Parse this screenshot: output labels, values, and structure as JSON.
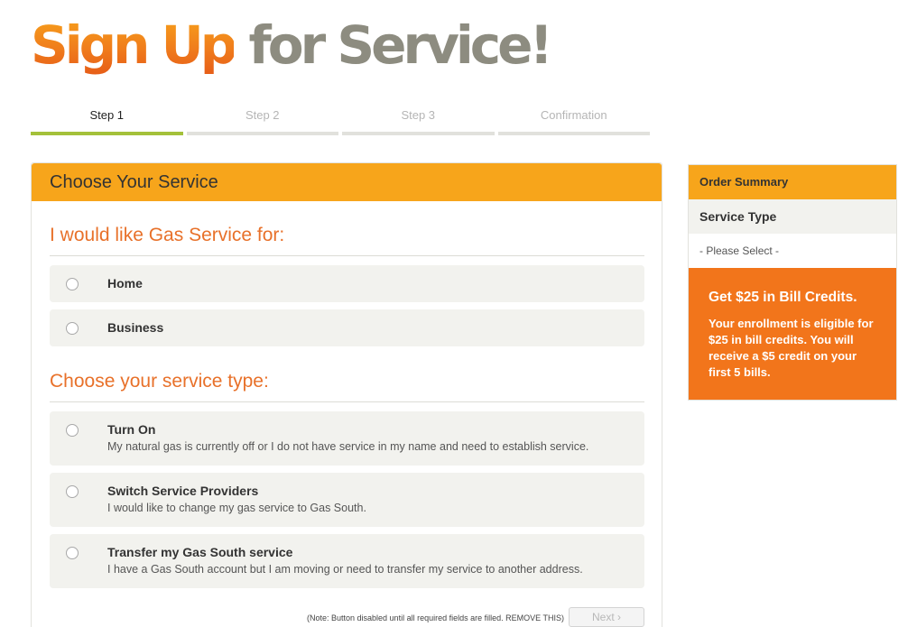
{
  "header": {
    "title_part1": "Sign Up",
    "title_part2": "for Service!"
  },
  "steps": [
    {
      "label": "Step 1",
      "active": true
    },
    {
      "label": "Step 2",
      "active": false
    },
    {
      "label": "Step 3",
      "active": false
    },
    {
      "label": "Confirmation",
      "active": false
    }
  ],
  "form": {
    "panel_title": "Choose Your Service",
    "section1_title": "I would like Gas Service for:",
    "service_for_options": [
      {
        "label": "Home",
        "selected": false
      },
      {
        "label": "Business",
        "selected": false
      }
    ],
    "section2_title": "Choose your service type:",
    "service_type_options": [
      {
        "label": "Turn On",
        "description": "My natural gas is currently off or I do not have service in my name and need to establish service.",
        "selected": false
      },
      {
        "label": "Switch Service Providers",
        "description": "I would like to change my gas service to Gas South.",
        "selected": false
      },
      {
        "label": "Transfer my Gas South service",
        "description": "I have a Gas South account but I am moving or need to transfer my service to another address.",
        "selected": false
      }
    ],
    "note": "(Note: Button disabled until all required fields are filled. REMOVE THIS)",
    "next_label": "Next ›"
  },
  "summary": {
    "title": "Order Summary",
    "service_type_label": "Service Type",
    "service_type_value": "- Please Select -",
    "promo_title": "Get $25 in Bill Credits.",
    "promo_text": "Your enrollment is eligible for $25 in bill credits. You will receive a $5 credit on your first 5 bills."
  },
  "colors": {
    "brand_orange": "#f7a51b",
    "accent_orange": "#e8712a",
    "promo_orange": "#f2751b",
    "step_active_green": "#a4c13a",
    "title_gray": "#8d8c80"
  }
}
